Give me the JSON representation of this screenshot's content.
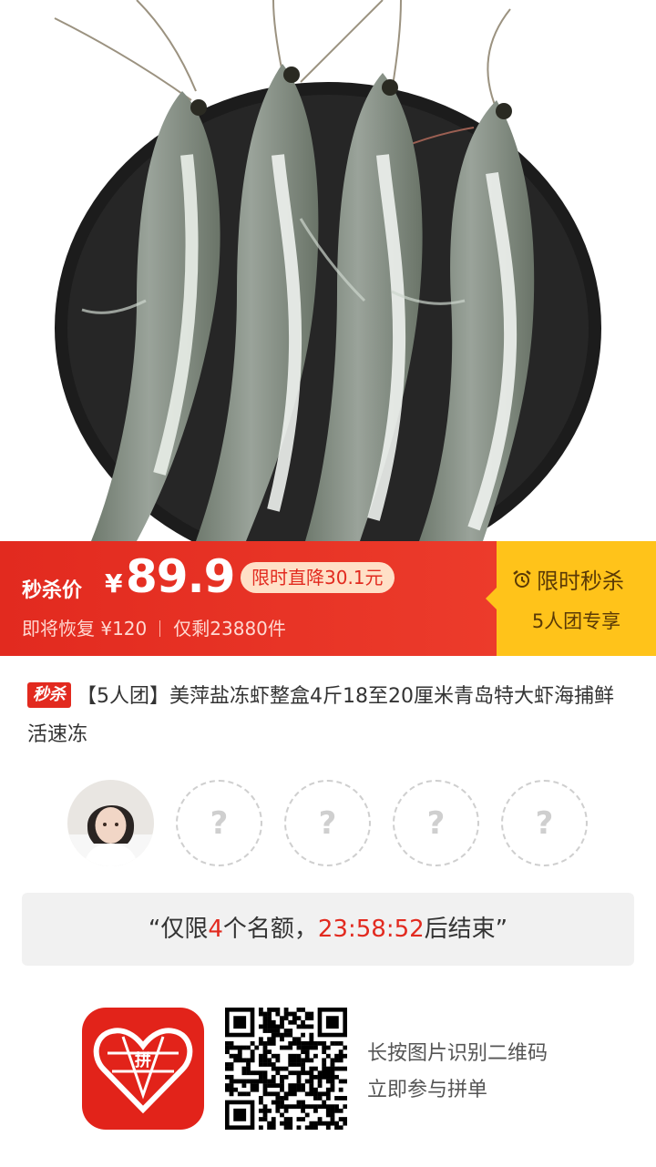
{
  "price_bar": {
    "seckill_label": "秒杀价",
    "currency": "¥",
    "price": "89.9",
    "drop_badge": "限时直降30.1元",
    "restore_text": "即将恢复 ¥120",
    "stock_text": "仅剩23880件",
    "flash_title": "限时秒杀",
    "flash_sub": "5人团专享"
  },
  "product": {
    "tag": "秒杀",
    "title": "【5人团】美萍盐冻虾整盒4斤18至20厘米青岛特大虾海捕鲜活速冻"
  },
  "group": {
    "empty_slot_symbol": "?",
    "slots_remaining": 4
  },
  "quota": {
    "prefix": "“仅限",
    "count": "4",
    "middle": "个名额，",
    "countdown": "23:58:52",
    "suffix": "后结束”"
  },
  "share": {
    "logo_glyph": "拼",
    "hint_line1": "长按图片识别二维码",
    "hint_line2": "立即参与拼单"
  },
  "colors": {
    "primary_red": "#e22a1f",
    "flash_yellow": "#ffc31a"
  }
}
